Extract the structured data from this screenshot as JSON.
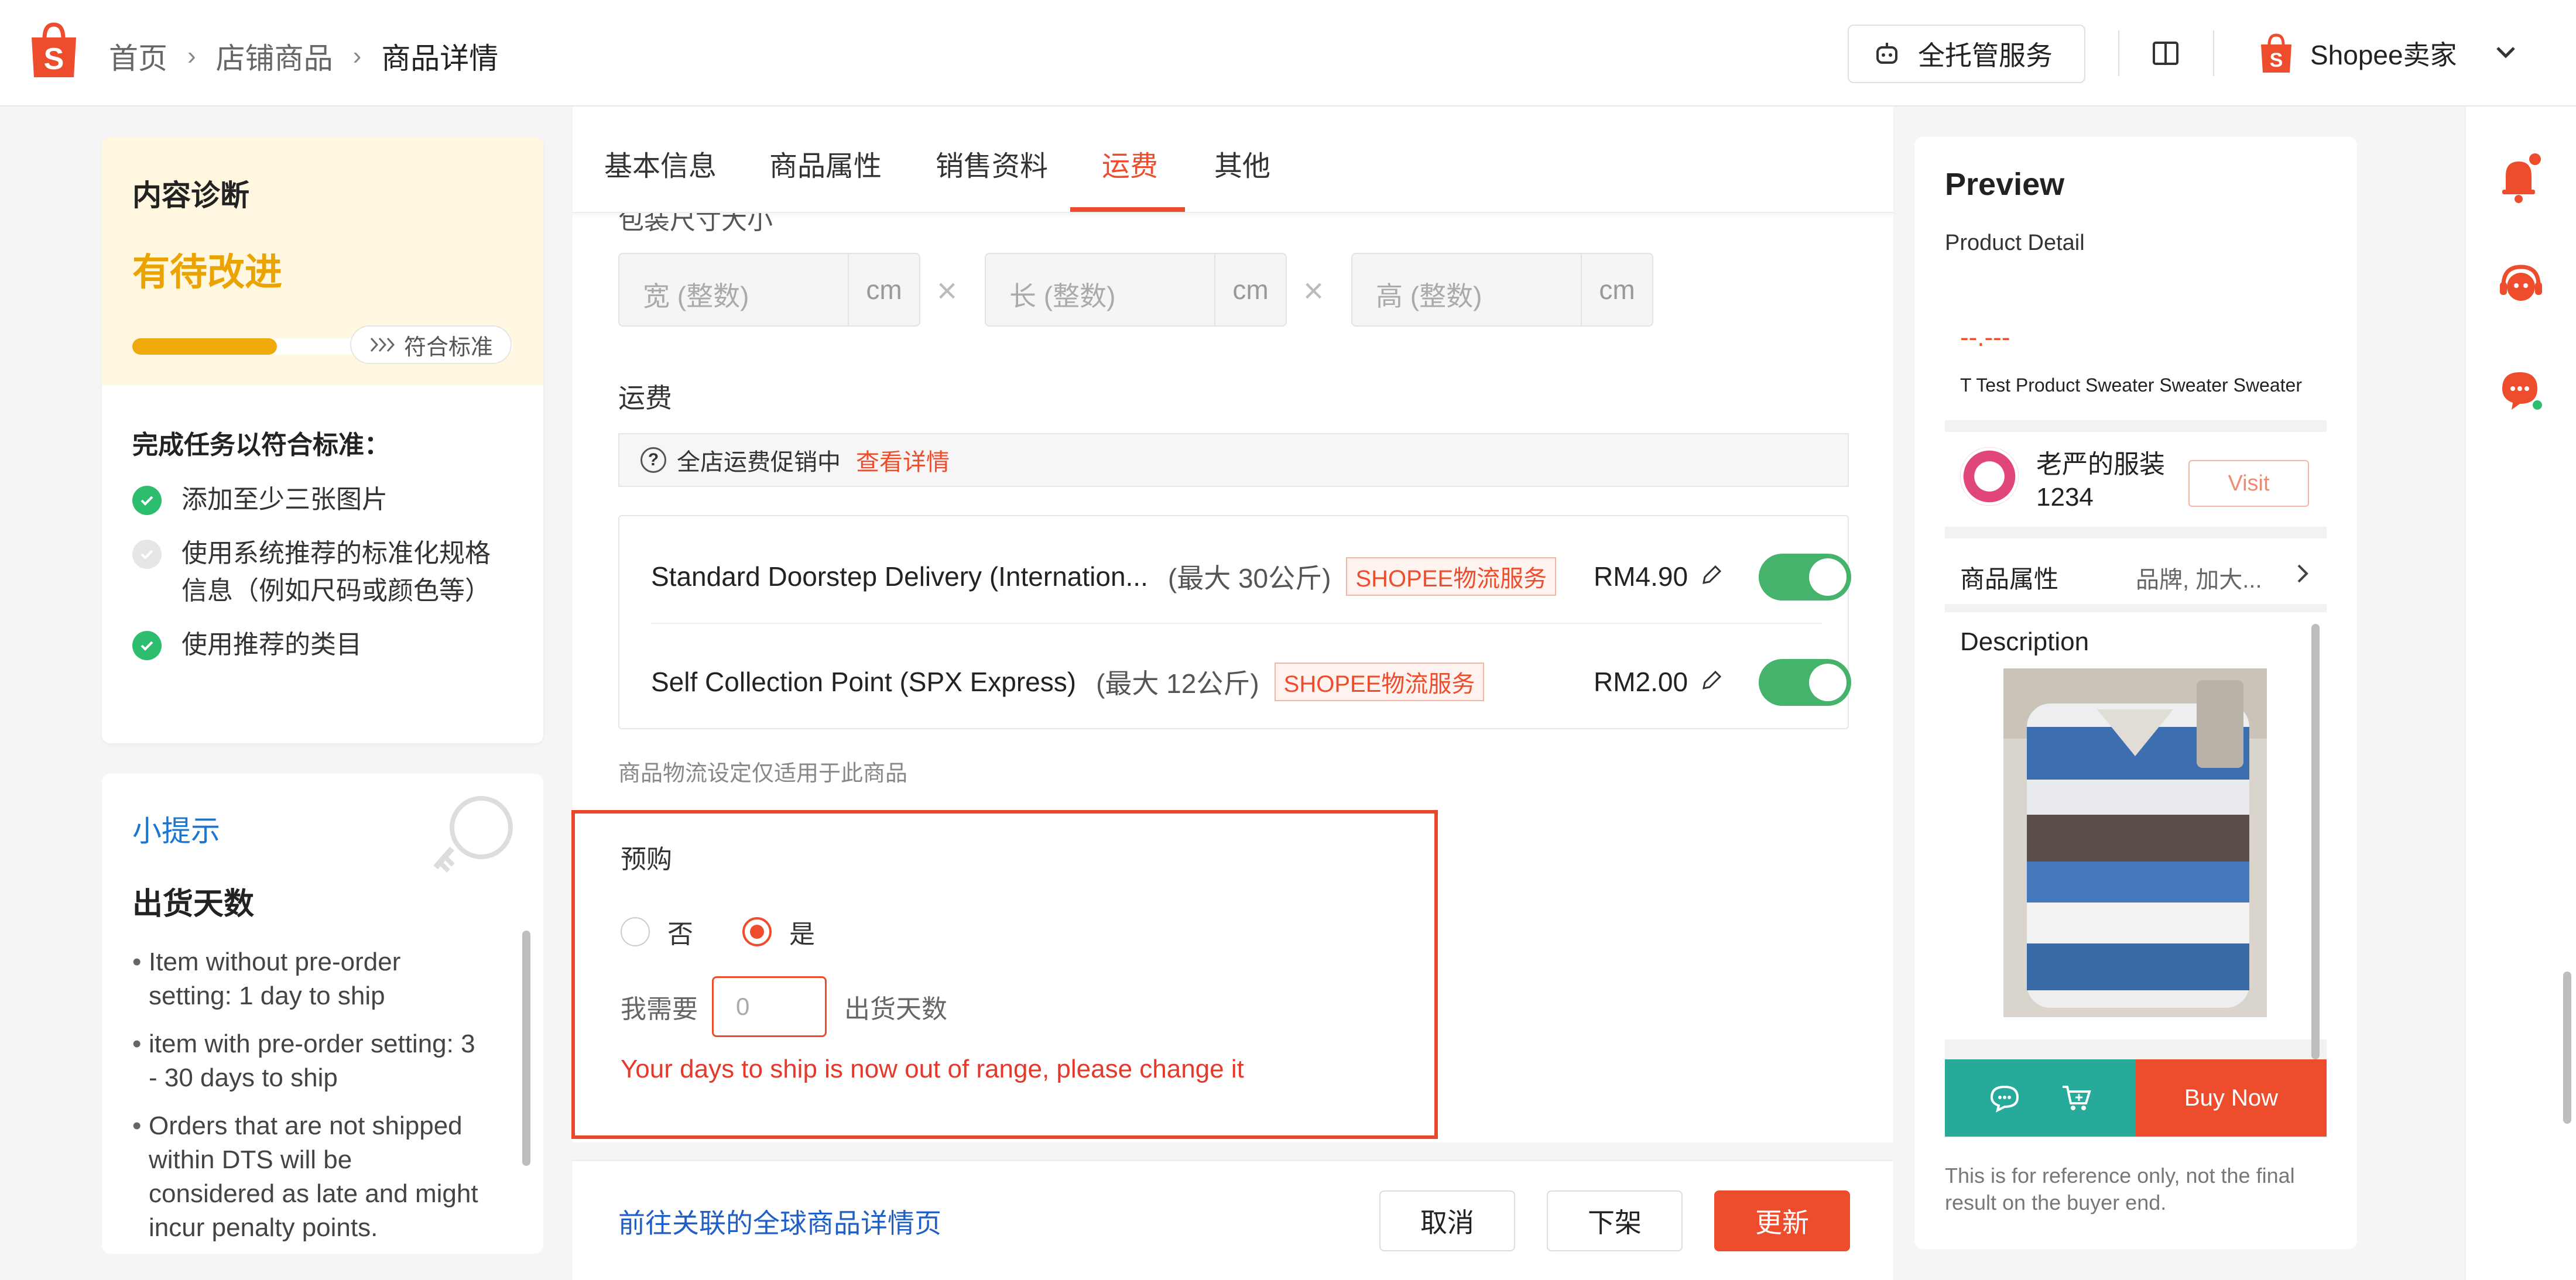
{
  "header": {
    "breadcrumbs": [
      "首页",
      "店铺商品",
      "商品详情"
    ],
    "service_button": "全托管服务",
    "seller_label": "Shopee卖家"
  },
  "diagnosis": {
    "title": "内容诊断",
    "status": "有待改进",
    "progress_percent": 38,
    "standard_label": "符合标准",
    "subtitle": "完成任务以符合标准：",
    "tasks": [
      {
        "text": "添加至少三张图片",
        "done": true
      },
      {
        "text": "使用系统推荐的标准化规格信息（例如尺码或颜色等）",
        "done": false
      },
      {
        "text": "使用推荐的类目",
        "done": true
      }
    ]
  },
  "tips": {
    "title": "小提示",
    "heading": "出货天数",
    "items": [
      "Item without pre-order setting: 1 day to ship",
      "item with pre-order setting: 3 - 30 days to ship",
      "Orders that are not shipped within DTS will be considered as late and might incur penalty points."
    ]
  },
  "tabs": [
    "基本信息",
    "商品属性",
    "销售资料",
    "运费",
    "其他"
  ],
  "active_tab": "运费",
  "package": {
    "cut_label": "包装尺寸大小",
    "width_placeholder": "宽 (整数)",
    "length_placeholder": "长 (整数)",
    "height_placeholder": "高 (整数)",
    "unit": "cm",
    "times": "×"
  },
  "shipping": {
    "label": "运费",
    "promo_text": "全店运费促销中",
    "promo_link": "查看详情",
    "options": [
      {
        "name": "Standard Doorstep Delivery (Internation...",
        "max": "(最大 30公斤)",
        "tag": "SHOPEE物流服务",
        "price": "RM4.90",
        "enabled": true
      },
      {
        "name": "Self Collection Point (SPX Express)",
        "max": "(最大 12公斤)",
        "tag": "SHOPEE物流服务",
        "price": "RM2.00",
        "enabled": true
      }
    ],
    "note": "商品物流设定仅适用于此商品"
  },
  "preorder": {
    "title": "预购",
    "option_no": "否",
    "option_yes": "是",
    "selected": "是",
    "days_prefix": "我需要",
    "days_placeholder": "0",
    "days_suffix": "出货天数",
    "error": "Your days to ship is now out of range, please change it"
  },
  "footer": {
    "link": "前往关联的全球商品详情页",
    "cancel": "取消",
    "delist": "下架",
    "update": "更新"
  },
  "preview": {
    "title": "Preview",
    "subtitle": "Product Detail",
    "price": "--.---",
    "product_name": "T Test Product Sweater Sweater Sweater",
    "shop_name": "老严的服装1234",
    "visit": "Visit",
    "attr_label": "商品属性",
    "attr_value": "品牌, 加大...",
    "description": "Description",
    "buy_now": "Buy Now",
    "note": "This is for reference only, not the final result on the buyer end."
  },
  "colors": {
    "brand": "#ee4d2d",
    "warning": "#eaa300",
    "success": "#2dbd6e",
    "toggle": "#45b36b",
    "teal": "#26aa99",
    "link": "#1f5fc6"
  }
}
